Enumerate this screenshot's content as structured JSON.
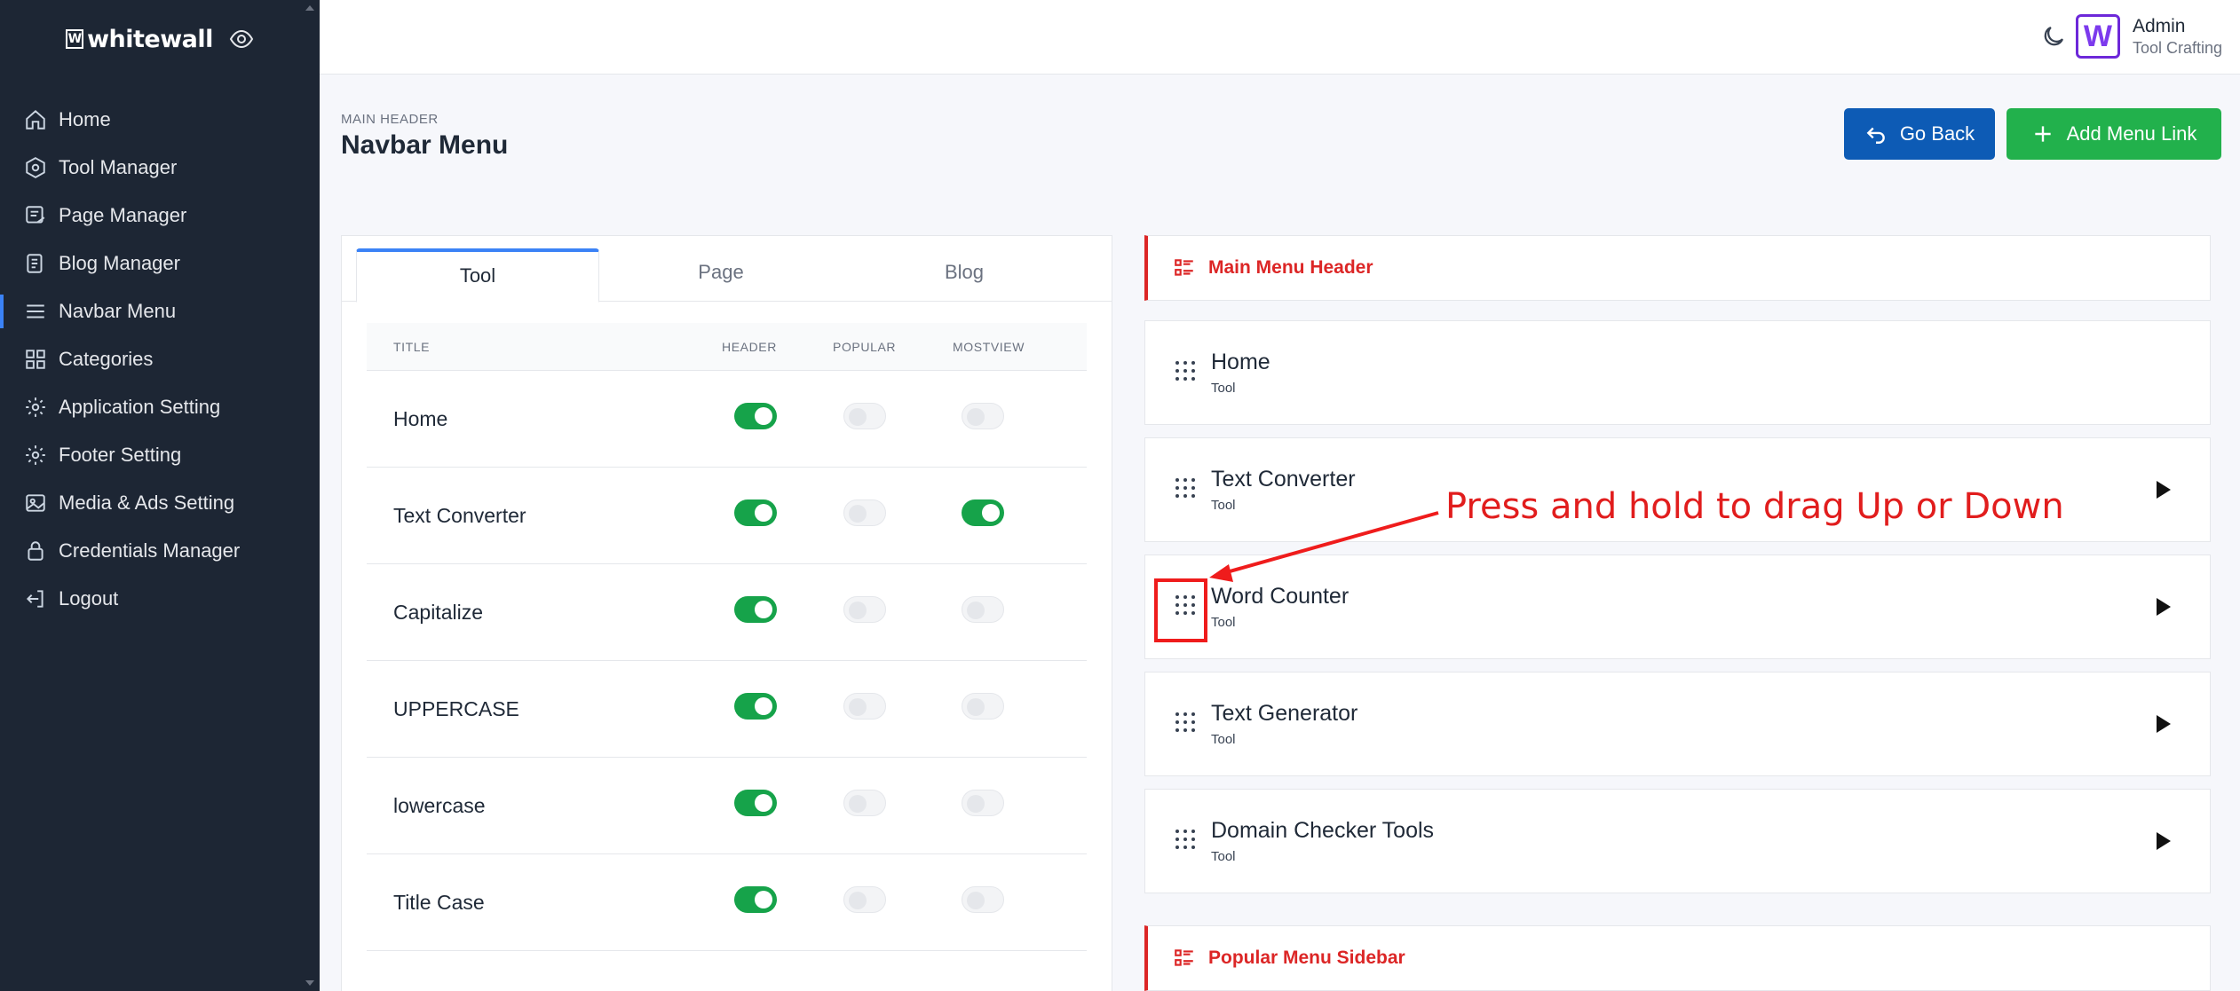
{
  "brand": {
    "name": "whitewall",
    "logo_letter": "W"
  },
  "sidebar": {
    "items": [
      {
        "label": "Home",
        "icon": "home-icon"
      },
      {
        "label": "Tool Manager",
        "icon": "hexagon-icon"
      },
      {
        "label": "Page Manager",
        "icon": "page-icon"
      },
      {
        "label": "Blog Manager",
        "icon": "blog-icon"
      },
      {
        "label": "Navbar Menu",
        "icon": "menu-icon",
        "active": true
      },
      {
        "label": "Categories",
        "icon": "grid-icon"
      },
      {
        "label": "Application Setting",
        "icon": "gear-icon"
      },
      {
        "label": "Footer Setting",
        "icon": "gear-icon"
      },
      {
        "label": "Media & Ads Setting",
        "icon": "image-icon"
      },
      {
        "label": "Credentials Manager",
        "icon": "lock-icon"
      },
      {
        "label": "Logout",
        "icon": "logout-icon"
      }
    ]
  },
  "user": {
    "name": "Admin",
    "role": "Tool Crafting",
    "avatar_letter": "W"
  },
  "header": {
    "eyebrow": "MAIN HEADER",
    "title": "Navbar Menu"
  },
  "buttons": {
    "back": "Go Back",
    "add": "Add Menu Link"
  },
  "tabs": [
    "Tool",
    "Page",
    "Blog"
  ],
  "table": {
    "columns": [
      "TITLE",
      "HEADER",
      "POPULAR",
      "MOSTVIEW"
    ],
    "rows": [
      {
        "title": "Home",
        "header": true,
        "popular": false,
        "mostview": false
      },
      {
        "title": "Text Converter",
        "header": true,
        "popular": false,
        "mostview": true
      },
      {
        "title": "Capitalize",
        "header": true,
        "popular": false,
        "mostview": false
      },
      {
        "title": "UPPERCASE",
        "header": true,
        "popular": false,
        "mostview": false
      },
      {
        "title": "lowercase",
        "header": true,
        "popular": false,
        "mostview": false
      },
      {
        "title": "Title Case",
        "header": true,
        "popular": false,
        "mostview": false
      }
    ]
  },
  "main_menu": {
    "title": "Main Menu Header",
    "items": [
      {
        "title": "Home",
        "type": "Tool",
        "expandable": false
      },
      {
        "title": "Text Converter",
        "type": "Tool",
        "expandable": true
      },
      {
        "title": "Word Counter",
        "type": "Tool",
        "expandable": true
      },
      {
        "title": "Text Generator",
        "type": "Tool",
        "expandable": true
      },
      {
        "title": "Domain Checker Tools",
        "type": "Tool",
        "expandable": true
      }
    ]
  },
  "popular_menu": {
    "title": "Popular Menu Sidebar"
  },
  "annotation": {
    "text": "Press and hold to drag Up or Down",
    "color": "#e11d1d"
  },
  "colors": {
    "sidebar_bg": "#1d2634",
    "primary": "#0d5bb5",
    "success": "#22b14c",
    "danger": "#dc2626",
    "toggle_on": "#16a34a"
  }
}
